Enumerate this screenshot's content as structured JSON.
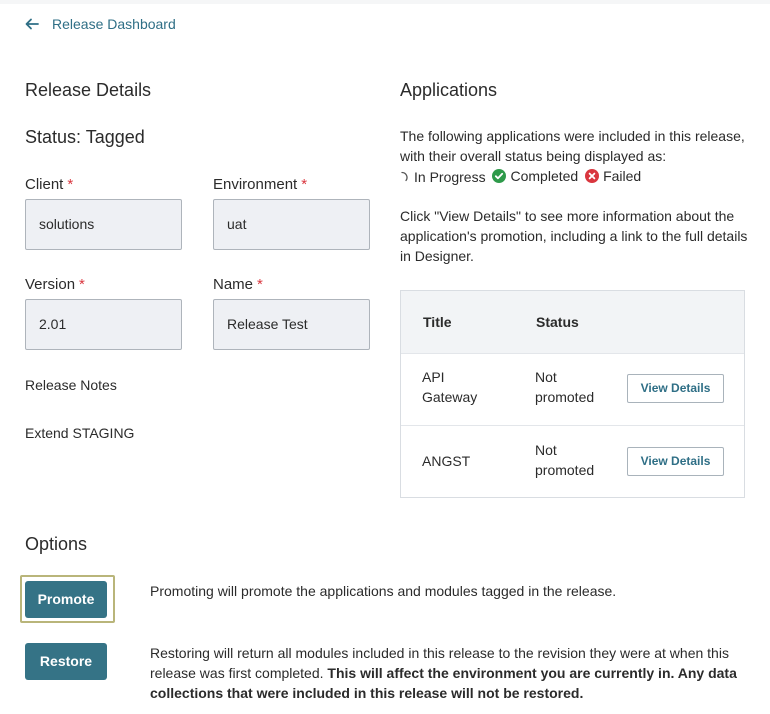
{
  "nav": {
    "back_label": "Release Dashboard"
  },
  "release_details": {
    "heading": "Release Details",
    "status": "Status: Tagged",
    "client": {
      "label": "Client",
      "required_mark": "*",
      "value": "solutions"
    },
    "environment": {
      "label": "Environment",
      "required_mark": "*",
      "value": "uat"
    },
    "version": {
      "label": "Version",
      "required_mark": "*",
      "value": "2.01"
    },
    "name": {
      "label": "Name",
      "required_mark": "*",
      "value": "Release Test"
    },
    "notes_label": "Release Notes",
    "notes_value": "Extend STAGING"
  },
  "applications": {
    "heading": "Applications",
    "desc_line1": "The following applications were included in this release, with their overall status being displayed as:",
    "legend": {
      "in_progress": "In Progress",
      "completed": "Completed",
      "failed": "Failed"
    },
    "desc2": "Click \"View Details\" to see more information about the application's promotion, including a link to the full details in Designer.",
    "table": {
      "col_title": "Title",
      "col_status": "Status",
      "rows": [
        {
          "title_line1": "API",
          "title_line2": "Gateway",
          "status_line1": "Not",
          "status_line2": "promoted",
          "action": "View Details"
        },
        {
          "title": "ANGST",
          "status_line1": "Not",
          "status_line2": "promoted",
          "action": "View Details"
        }
      ]
    }
  },
  "options": {
    "heading": "Options",
    "promote_label": "Promote",
    "promote_desc": "Promoting will promote the applications and modules tagged in the release.",
    "restore_label": "Restore",
    "restore_desc": "Restoring will return all modules included in this release to the revision they were at when this release was first completed.",
    "restore_warning": "This will affect the environment you are currently in. Any data collections that were included in this release will not be restored."
  },
  "colors": {
    "accent": "#357386",
    "link": "#2f6f86",
    "required": "#d9363e",
    "completed": "#2e9a4a",
    "failed": "#d9363e"
  }
}
